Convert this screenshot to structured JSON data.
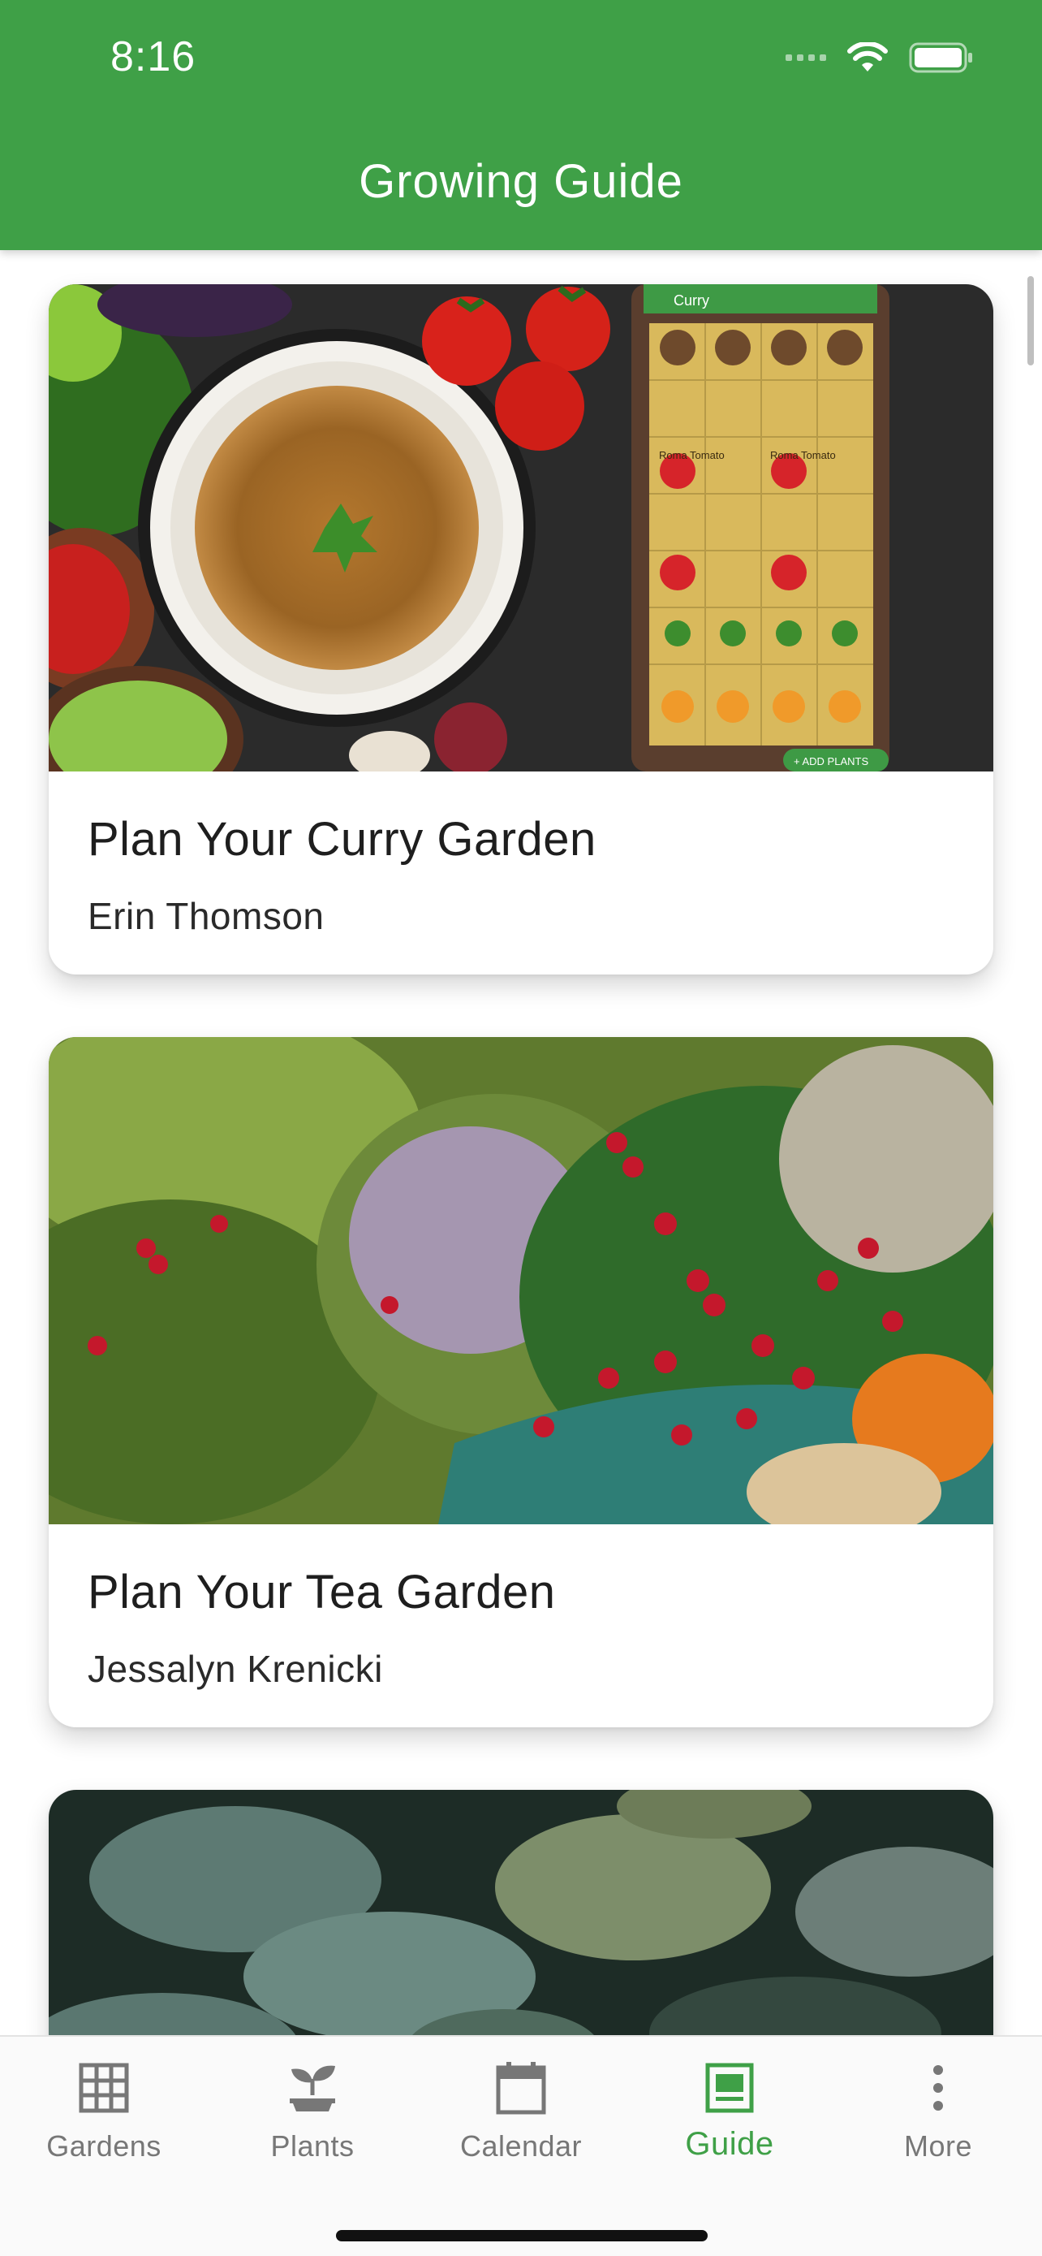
{
  "status_bar": {
    "time": "8:16"
  },
  "header": {
    "title": "Growing Guide"
  },
  "cards": [
    {
      "title": "Plan Your Curry Garden",
      "author": "Erin Thomson",
      "image_labels": {
        "app_header": "Curry",
        "tomato": "Roma Tomato",
        "add_button": "+ ADD PLANTS"
      }
    },
    {
      "title": "Plan Your Tea Garden",
      "author": "Jessalyn Krenicki"
    },
    {
      "title": "",
      "author": ""
    }
  ],
  "tabs": [
    {
      "label": "Gardens",
      "icon": "grid-icon",
      "active": false
    },
    {
      "label": "Plants",
      "icon": "sprout-icon",
      "active": false
    },
    {
      "label": "Calendar",
      "icon": "calendar-icon",
      "active": false
    },
    {
      "label": "Guide",
      "icon": "guide-icon",
      "active": true
    },
    {
      "label": "More",
      "icon": "more-vertical-icon",
      "active": false
    }
  ],
  "colors": {
    "brand_green": "#3fa047",
    "inactive_tab": "#777777"
  }
}
